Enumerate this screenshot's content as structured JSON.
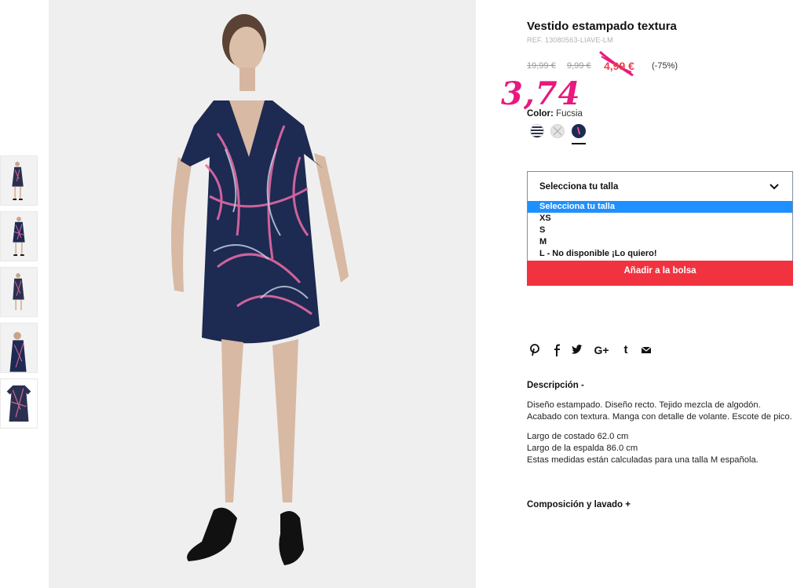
{
  "product": {
    "title": "Vestido estampado textura",
    "ref": "REF. 13080563-LIAVE-LM"
  },
  "prices": {
    "original": "19,99 €",
    "previous": "9,99 €",
    "sale": "4,99 €",
    "discount": "(-75%)",
    "handwritten_price": "3,74"
  },
  "color": {
    "label": "Color:",
    "value": "Fucsia",
    "swatches": [
      {
        "name": "stripes-navy-white",
        "color": "#2b3447"
      },
      {
        "name": "grey-unavailable",
        "color": "#e4e4e4"
      },
      {
        "name": "navy-print",
        "color": "#1d2a52",
        "selected": true
      }
    ]
  },
  "size_select": {
    "label": "Selecciona tu talla",
    "options": [
      "Selecciona tu talla",
      "XS",
      "S",
      "M",
      "L - No disponible ¡Lo quiero!"
    ],
    "highlighted_option": "Selecciona tu talla"
  },
  "add_to_bag": "Añadir a la bolsa",
  "social": [
    "pinterest-icon",
    "facebook-icon",
    "twitter-icon",
    "google-plus-icon",
    "tumblr-icon",
    "email-icon"
  ],
  "social_labels": {
    "googleplus": "G+",
    "tumblr": "t"
  },
  "description": {
    "heading": "Descripción -",
    "text": "Diseño estampado. Diseño recto. Tejido mezcla de algodón. Acabado con textura. Manga con detalle de volante. Escote de pico.",
    "measure1": "Largo de costado 62.0 cm",
    "measure2": "Largo de la espalda 86.0 cm",
    "measure3": "Estas medidas están calculadas para una talla M española."
  },
  "composition_heading": "Composición y lavado +",
  "colors": {
    "sale_red": "#e9414b",
    "button_red": "#f13340",
    "handwritten_pink": "#e8197f",
    "dress_navy": "#1d2a52",
    "highlight_blue": "#1e90ff"
  }
}
